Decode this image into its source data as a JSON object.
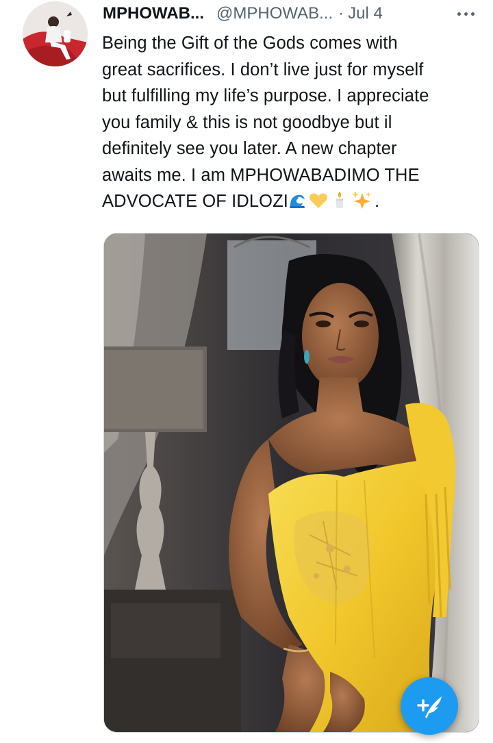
{
  "tweet": {
    "author_name": "MPHOWAB...",
    "author_handle": "@MPHOWAB...",
    "separator": "·",
    "date": "Jul 4",
    "lines": [
      "Being the Gift of the Gods comes with",
      "great sacrifices. I don’t live just for myself",
      "but fulfilling my life’s purpose. I appreciate",
      "you family & this is not goodbye but il",
      "definitely see you later. A new chapter",
      "awaits me. I am MPHOWABADIMO THE"
    ],
    "last_line_text": "ADVOCATE OF IDLOZI",
    "last_line_end": ".",
    "emojis": [
      "wave",
      "yellow-heart",
      "candle",
      "sparkles"
    ]
  },
  "colors": {
    "accent": "#1d9bf0",
    "text": "#0f1419",
    "secondary": "#536471",
    "dress": "#f5d23a"
  },
  "icons": {
    "more": "more-dots-icon",
    "compose": "compose-tweet-icon"
  }
}
